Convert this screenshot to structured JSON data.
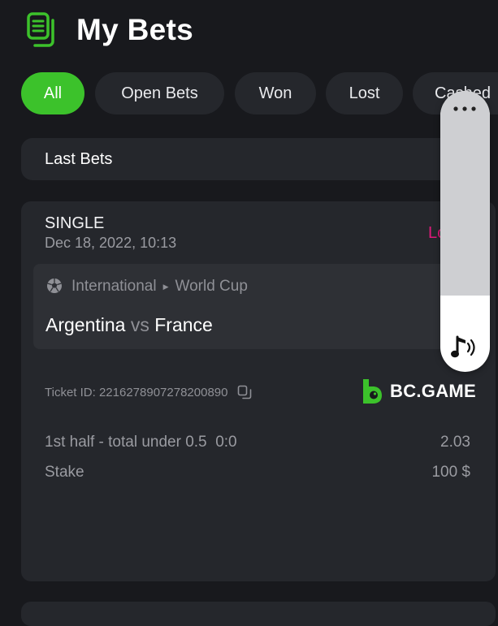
{
  "header": {
    "title": "My Bets",
    "icon": "bets-list-icon",
    "accent": "#3cc22b"
  },
  "filters": [
    {
      "label": "All",
      "active": true
    },
    {
      "label": "Open Bets",
      "active": false
    },
    {
      "label": "Won",
      "active": false
    },
    {
      "label": "Lost",
      "active": false
    },
    {
      "label": "Cashed",
      "active": false
    }
  ],
  "section": {
    "title": "Last Bets"
  },
  "bet": {
    "type": "SINGLE",
    "date": "Dec 18, 2022, 10:13",
    "status": "Lost",
    "status_color": "#e0197a",
    "sport_icon": "soccer-ball-icon",
    "category": "International",
    "league": "World Cup",
    "team_home": "Argentina",
    "vs": "vs",
    "team_away": "France",
    "ticket_label": "Ticket ID:",
    "ticket_id": "2216278907278200890",
    "brand": "BC.GAME",
    "selection": "1st half - total under 0.5",
    "score": "0:0",
    "odds": "2.03",
    "stake_label": "Stake",
    "stake_value": "100 $"
  },
  "overlay": {
    "more_icon": "more-horizontal-icon",
    "sound_icon": "music-note-sound-icon"
  }
}
